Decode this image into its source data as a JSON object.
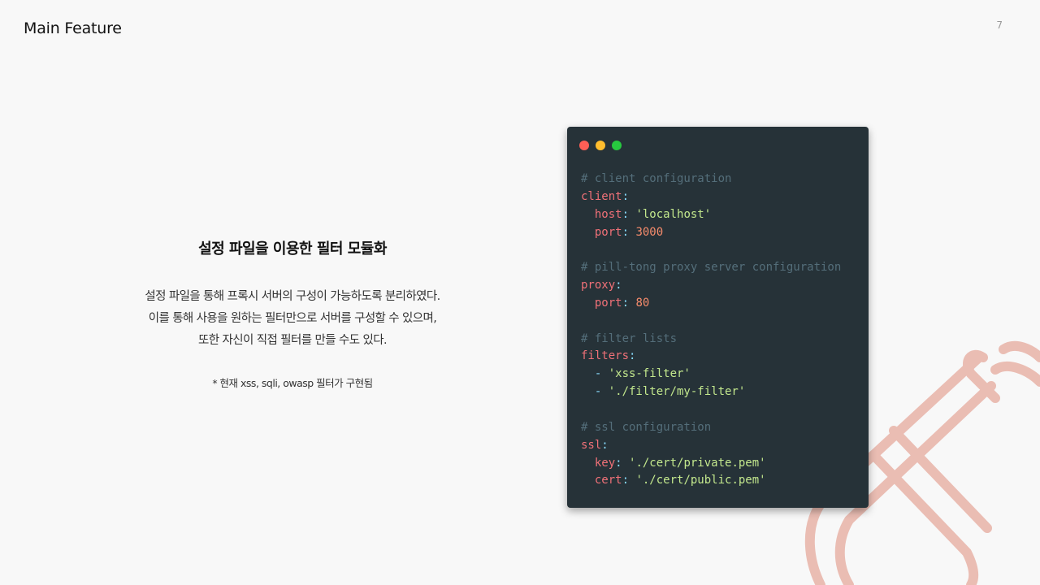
{
  "header": {
    "title": "Main Feature",
    "page_number": "7"
  },
  "feature": {
    "title": "설정 파일을 이용한 필터 모듈화",
    "description": [
      "설정 파일을 통해 프록시 서버의 구성이 가능하도록 분리하였다.",
      "이를 통해 사용을 원하는 필터만으로 서버를 구성할 수 있으며,",
      "또한 자신이 직접 필터를 만들 수도 있다."
    ],
    "note": "* 현재 xss, sqli, owasp 필터가 구현됨"
  },
  "code_window": {
    "dots": [
      {
        "name": "close-dot",
        "color": "#ff5f56"
      },
      {
        "name": "minimize-dot",
        "color": "#ffbd2e"
      },
      {
        "name": "maximize-dot",
        "color": "#27c93f"
      }
    ],
    "lines": [
      [
        {
          "t": "comment",
          "v": "# client configuration"
        }
      ],
      [
        {
          "t": "key",
          "v": "client"
        },
        {
          "t": "punc",
          "v": ":"
        }
      ],
      [
        {
          "t": "plain",
          "v": "  "
        },
        {
          "t": "key",
          "v": "host"
        },
        {
          "t": "punc",
          "v": ": "
        },
        {
          "t": "str",
          "v": "'localhost'"
        }
      ],
      [
        {
          "t": "plain",
          "v": "  "
        },
        {
          "t": "key",
          "v": "port"
        },
        {
          "t": "punc",
          "v": ": "
        },
        {
          "t": "num",
          "v": "3000"
        }
      ],
      [],
      [
        {
          "t": "comment",
          "v": "# pill-tong proxy server configuration"
        }
      ],
      [
        {
          "t": "key",
          "v": "proxy"
        },
        {
          "t": "punc",
          "v": ":"
        }
      ],
      [
        {
          "t": "plain",
          "v": "  "
        },
        {
          "t": "key",
          "v": "port"
        },
        {
          "t": "punc",
          "v": ": "
        },
        {
          "t": "num",
          "v": "80"
        }
      ],
      [],
      [
        {
          "t": "comment",
          "v": "# filter lists"
        }
      ],
      [
        {
          "t": "key",
          "v": "filters"
        },
        {
          "t": "punc",
          "v": ":"
        }
      ],
      [
        {
          "t": "plain",
          "v": "  "
        },
        {
          "t": "punc",
          "v": "- "
        },
        {
          "t": "str",
          "v": "'xss-filter'"
        }
      ],
      [
        {
          "t": "plain",
          "v": "  "
        },
        {
          "t": "punc",
          "v": "- "
        },
        {
          "t": "str",
          "v": "'./filter/my-filter'"
        }
      ],
      [],
      [
        {
          "t": "comment",
          "v": "# ssl configuration"
        }
      ],
      [
        {
          "t": "key",
          "v": "ssl"
        },
        {
          "t": "punc",
          "v": ":"
        }
      ],
      [
        {
          "t": "plain",
          "v": "  "
        },
        {
          "t": "key",
          "v": "key"
        },
        {
          "t": "punc",
          "v": ": "
        },
        {
          "t": "str",
          "v": "'./cert/private.pem'"
        }
      ],
      [
        {
          "t": "plain",
          "v": "  "
        },
        {
          "t": "key",
          "v": "cert"
        },
        {
          "t": "punc",
          "v": ": "
        },
        {
          "t": "str",
          "v": "'./cert/public.pem'"
        }
      ]
    ]
  },
  "colors": {
    "background": "#f8f8f8",
    "code_background": "#263238",
    "decoration_stroke": "#e8b3a8"
  }
}
